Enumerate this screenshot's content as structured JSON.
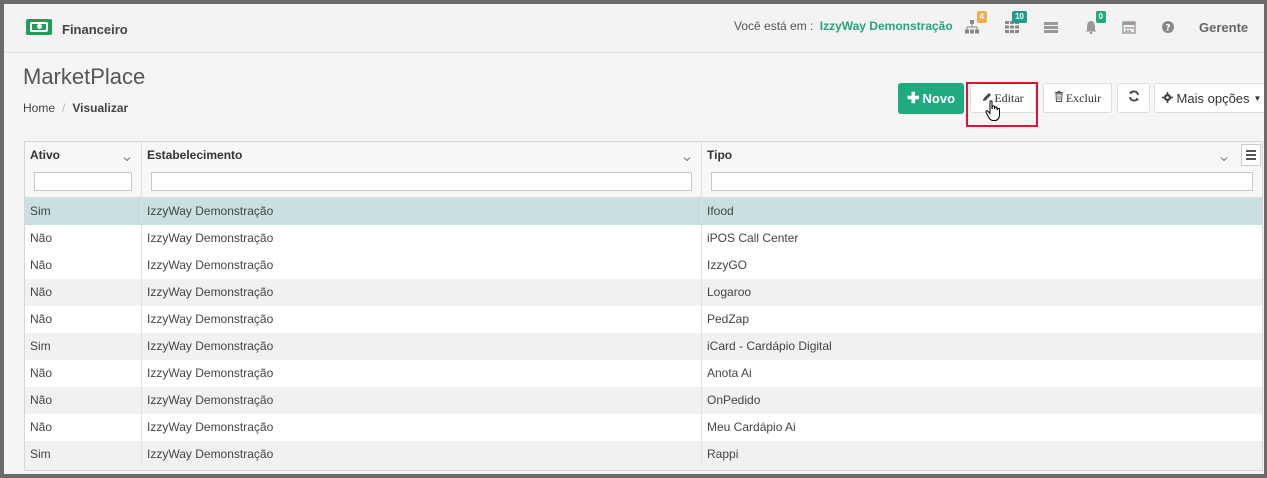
{
  "topbar": {
    "module_label": "Financeiro",
    "location_prefix": "Você está em :",
    "company": "IzzyWay Demonstração",
    "user": "Gerente",
    "icons": [
      {
        "name": "sitemap-icon",
        "badge": "4",
        "badge_color": "#f0ad4e"
      },
      {
        "name": "grid-icon",
        "badge": "10",
        "badge_color": "#1f9d8a"
      },
      {
        "name": "server-icon",
        "badge": ""
      },
      {
        "name": "bell-icon",
        "badge": "0",
        "badge_color": "#1fab7f"
      },
      {
        "name": "calendar-icon",
        "badge": ""
      },
      {
        "name": "help-icon",
        "badge": ""
      }
    ]
  },
  "page": {
    "title": "MarketPlace",
    "breadcrumb": {
      "home": "Home",
      "sep": "/",
      "current": "Visualizar"
    }
  },
  "toolbar": {
    "novo_label": "Novo",
    "editar_label": "Editar",
    "excluir_label": "Excluir",
    "mais_label": "Mais opções"
  },
  "grid": {
    "columns": [
      "Ativo",
      "Estabelecimento",
      "Tipo"
    ],
    "rows": [
      [
        "Sim",
        "IzzyWay Demonstração",
        "Ifood"
      ],
      [
        "Não",
        "IzzyWay Demonstração",
        "iPOS Call Center"
      ],
      [
        "Não",
        "IzzyWay Demonstração",
        "IzzyGO"
      ],
      [
        "Não",
        "IzzyWay Demonstração",
        "Logaroo"
      ],
      [
        "Não",
        "IzzyWay Demonstração",
        "PedZap"
      ],
      [
        "Sim",
        "IzzyWay Demonstração",
        "iCard - Cardápio Digital"
      ],
      [
        "Não",
        "IzzyWay Demonstração",
        "Anota Ai"
      ],
      [
        "Não",
        "IzzyWay Demonstração",
        "OnPedido"
      ],
      [
        "Não",
        "IzzyWay Demonstração",
        "Meu Cardápio Ai"
      ],
      [
        "Sim",
        "IzzyWay Demonstração",
        "Rappi"
      ]
    ],
    "selected_row": 0
  },
  "colors": {
    "accent": "#1fab7f",
    "company": "#27a37c",
    "highlight": "#d9162b",
    "selected": "#c9dfe0"
  }
}
